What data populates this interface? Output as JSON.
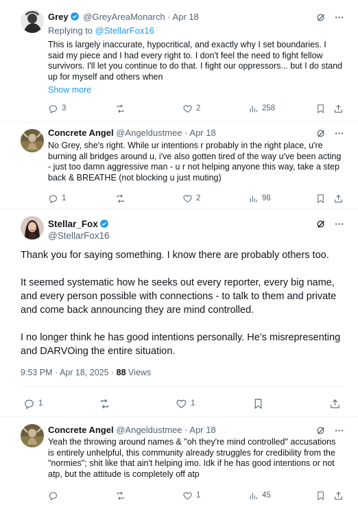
{
  "tweets": [
    {
      "name": "Grey",
      "handle": "@GreyAreaMonarch",
      "date": "Apr 18",
      "replying_prefix": "Replying to ",
      "replying_to": "@StellarFox16",
      "text": "This is largely inaccurate, hypocritical, and exactly why I set boundaries. I said my piece and I had every right to. I don't feel the need to fight fellow survivors. I'll let you continue to do that. I fight our oppressors... but I do stand up for myself and others when",
      "show_more": "Show more",
      "replies": "3",
      "reposts": "",
      "likes": "2",
      "views": "258"
    },
    {
      "name": "Concrete Angel",
      "handle": "@Angeldustmee",
      "date": "Apr 18",
      "text": "No Grey, she's right. While ur intentions r probably in the right place, u're burning all bridges around u, i've also gotten tired of the way u've been acting - just too damn aggressive man - u r not helping anyone this way, take a step back & BREATHE (not blocking u just muting)",
      "replies": "1",
      "reposts": "",
      "likes": "2",
      "views": "98"
    },
    {
      "name": "Concrete Angel",
      "handle": "@Angeldustmee",
      "date": "Apr 18",
      "text": "Yeah the throwing around names & \"oh they're mind controlled\" accusations is entirely unhelpful, this community already struggles for credibility from the \"normies\"; shit like that ain't helping imo. Idk if he has good intentions or not atp, but the attitude is completely off atp",
      "replies": "",
      "reposts": "",
      "likes": "1",
      "views": "45"
    }
  ],
  "main": {
    "name": "Stellar_Fox",
    "handle": "@StellarFox16",
    "paragraphs": [
      "Thank you for saying something. I know there are probably others too.",
      "It seemed systematic how he seeks out every reporter, every big name, and every person possible with connections - to talk to them and private and come back announcing they are mind controlled.",
      "I no longer think he has good intentions personally. He’s misrepresenting and DARVOing the entire situation."
    ],
    "time": "9:53 PM · Apr 18, 2025 · ",
    "views_count": "88",
    "views_label": " Views",
    "replies": "1",
    "reposts": "",
    "likes": "1"
  },
  "icons": {
    "reply": "reply-icon",
    "repost": "repost-icon",
    "like": "heart-icon",
    "views": "views-icon",
    "bookmark": "bookmark-icon",
    "share": "share-icon",
    "grok": "grok-icon",
    "more": "more-icon",
    "verified": "verified-badge-icon"
  },
  "colors": {
    "accent": "#1d9bf0",
    "muted": "#536471",
    "text": "#0f1419"
  }
}
